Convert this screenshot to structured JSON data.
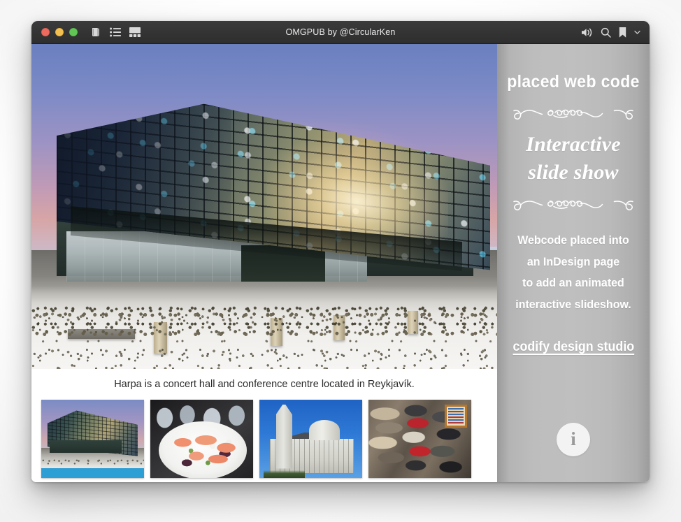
{
  "window": {
    "title": "OMGPUB by @CircularKen",
    "traffic_lights": [
      "close",
      "minimize",
      "zoom"
    ],
    "toolbar_icons": [
      "library-icon",
      "table-of-contents-icon",
      "thumbnail-grid-icon"
    ],
    "right_icons": [
      "volume-icon",
      "search-icon",
      "bookmark-icon",
      "chevron-down-icon"
    ]
  },
  "slideshow": {
    "caption": "Harpa is a concert hall and conference centre located in Reykjavík.",
    "active_index": 0,
    "active_color": "#2e9fd4",
    "thumbnails": [
      {
        "label": "Harpa concert hall",
        "active": true
      },
      {
        "label": "Salmon dish",
        "active": false
      },
      {
        "label": "Hallgrimskirkja church",
        "active": false
      },
      {
        "label": "Icelandic wool sweaters",
        "active": false
      }
    ]
  },
  "ad_panel": {
    "kicker": "placed web code",
    "headline_line1": "Interactive",
    "headline_line2": "slide show",
    "blurb_lines": [
      "Webcode placed into",
      "an InDesign page",
      "to add an animated",
      "interactive slideshow."
    ],
    "studio_link": "codify design studio",
    "info_glyph": "i",
    "panel_color": "#bfbfbf",
    "text_color": "#ffffff"
  }
}
